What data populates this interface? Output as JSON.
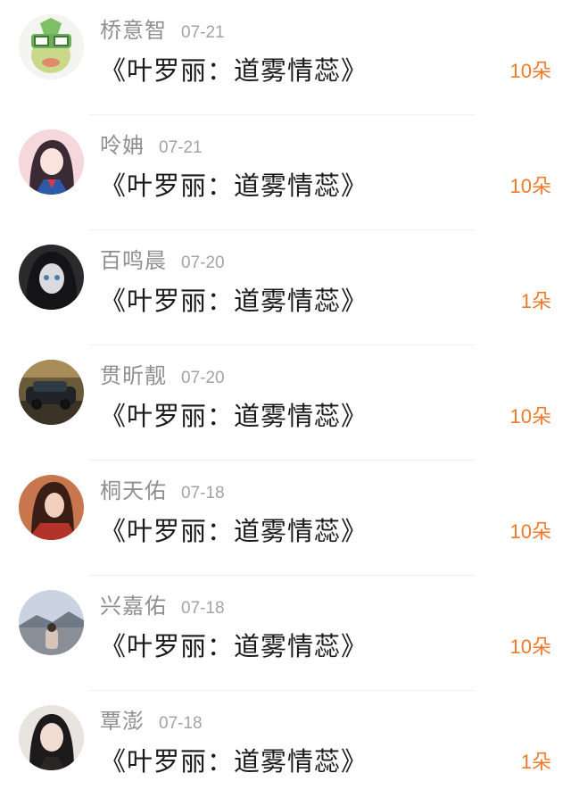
{
  "gifts": [
    {
      "name": "桥意智",
      "date": "07-21",
      "title": "《叶罗丽：道雾情蕊》",
      "count": "10朵",
      "avatar": "cartoon-green-character-avatar"
    },
    {
      "name": "呤姌",
      "date": "07-21",
      "title": "《叶罗丽：道雾情蕊》",
      "count": "10朵",
      "avatar": "anime-girl-avatar"
    },
    {
      "name": "百鸣晨",
      "date": "07-20",
      "title": "《叶罗丽：道雾情蕊》",
      "count": "1朵",
      "avatar": "dark-anime-girl-avatar"
    },
    {
      "name": "贯昕靓",
      "date": "07-20",
      "title": "《叶罗丽：道雾情蕊》",
      "count": "10朵",
      "avatar": "car-photo-avatar"
    },
    {
      "name": "桐天佑",
      "date": "07-18",
      "title": "《叶罗丽：道雾情蕊》",
      "count": "10朵",
      "avatar": "red-costume-girl-avatar"
    },
    {
      "name": "兴嘉佑",
      "date": "07-18",
      "title": "《叶罗丽：道雾情蕊》",
      "count": "10朵",
      "avatar": "landscape-photo-avatar"
    },
    {
      "name": "覃澎",
      "date": "07-18",
      "title": "《叶罗丽：道雾情蕊》",
      "count": "1朵",
      "avatar": "girl-portrait-avatar"
    }
  ]
}
